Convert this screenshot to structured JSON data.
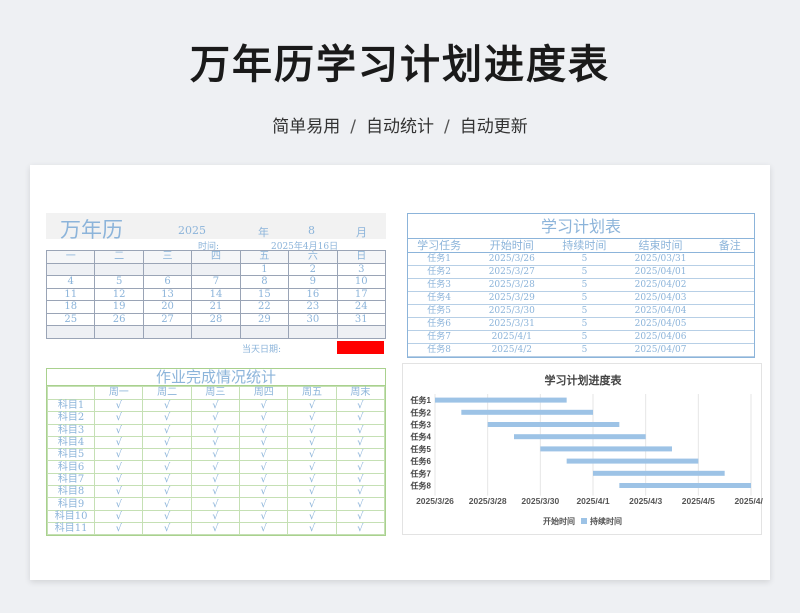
{
  "header": {
    "title": "万年历学习计划进度表",
    "subtitle_items": [
      "简单易用",
      "自动统计",
      "自动更新"
    ],
    "separator": "/"
  },
  "calendar": {
    "title": "万年历",
    "year": "2025",
    "year_unit": "年",
    "month": "8",
    "month_unit": "月",
    "time_label": "时间:",
    "date_text": "2025年4月16日",
    "weekdays": [
      "一",
      "二",
      "三",
      "四",
      "五",
      "六",
      "日"
    ],
    "weeks": [
      [
        "",
        "",
        "",
        "",
        "1",
        "2",
        "3"
      ],
      [
        "4",
        "5",
        "6",
        "7",
        "8",
        "9",
        "10"
      ],
      [
        "11",
        "12",
        "13",
        "14",
        "15",
        "16",
        "17"
      ],
      [
        "18",
        "19",
        "20",
        "21",
        "22",
        "23",
        "24"
      ],
      [
        "25",
        "26",
        "27",
        "28",
        "29",
        "30",
        "31"
      ],
      [
        "",
        "",
        "",
        "",
        "",
        "",
        ""
      ]
    ],
    "today_label": "当天日期:",
    "today_color": "#ff0000"
  },
  "plan": {
    "title": "学习计划表",
    "columns": [
      "学习任务",
      "开始时间",
      "持续时间",
      "结束时间",
      "备注"
    ],
    "rows": [
      [
        "任务1",
        "2025/3/26",
        "5",
        "2025/03/31",
        ""
      ],
      [
        "任务2",
        "2025/3/27",
        "5",
        "2025/04/01",
        ""
      ],
      [
        "任务3",
        "2025/3/28",
        "5",
        "2025/04/02",
        ""
      ],
      [
        "任务4",
        "2025/3/29",
        "5",
        "2025/04/03",
        ""
      ],
      [
        "任务5",
        "2025/3/30",
        "5",
        "2025/04/04",
        ""
      ],
      [
        "任务6",
        "2025/3/31",
        "5",
        "2025/04/05",
        ""
      ],
      [
        "任务7",
        "2025/4/1",
        "5",
        "2025/04/06",
        ""
      ],
      [
        "任务8",
        "2025/4/2",
        "5",
        "2025/04/07",
        ""
      ]
    ]
  },
  "homework": {
    "title": "作业完成情况统计",
    "columns": [
      "",
      "周一",
      "周二",
      "周三",
      "周四",
      "周五",
      "周末"
    ],
    "check": "√",
    "subjects": [
      "科目1",
      "科目2",
      "科目3",
      "科目4",
      "科目5",
      "科目6",
      "科目7",
      "科目8",
      "科目9",
      "科目10",
      "科目11"
    ]
  },
  "chart_data": {
    "type": "bar",
    "orientation": "horizontal-stacked",
    "title": "学习计划进度表",
    "categories": [
      "任务1",
      "任务2",
      "任务3",
      "任务4",
      "任务5",
      "任务6",
      "任务7",
      "任务8"
    ],
    "x_ticks": [
      "2025/3/26",
      "2025/3/28",
      "2025/3/30",
      "2025/4/1",
      "2025/4/3",
      "2025/4/5",
      "2025/4/7"
    ],
    "xlim": [
      "2025-03-26",
      "2025-04-07"
    ],
    "series": [
      {
        "name": "开始时间",
        "values": [
          "2025-03-26",
          "2025-03-27",
          "2025-03-28",
          "2025-03-29",
          "2025-03-30",
          "2025-03-31",
          "2025-04-01",
          "2025-04-02"
        ],
        "color": "none"
      },
      {
        "name": "持续时间",
        "values": [
          5,
          5,
          5,
          5,
          5,
          5,
          5,
          5
        ],
        "color": "#9dc3e6"
      }
    ],
    "grid": true,
    "legend": "bottom"
  }
}
